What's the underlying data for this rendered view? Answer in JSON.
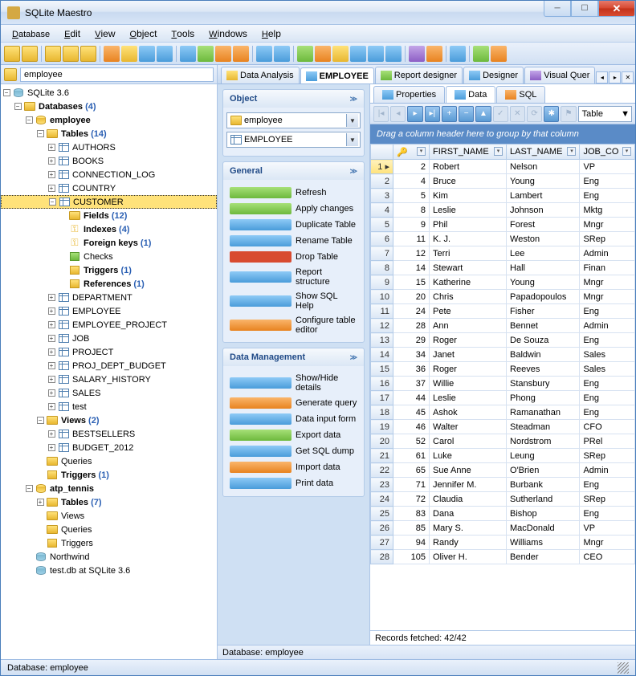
{
  "app": {
    "title": "SQLite Maestro"
  },
  "menus": [
    "Database",
    "Edit",
    "View",
    "Object",
    "Tools",
    "Windows",
    "Help"
  ],
  "addressbar": {
    "value": "employee"
  },
  "tree": {
    "root": {
      "label": "SQLite 3.6"
    },
    "databases": {
      "label": "Databases",
      "count": "(4)"
    },
    "employee": {
      "label": "employee"
    },
    "tables": {
      "label": "Tables",
      "count": "(14)"
    },
    "table_items": [
      "AUTHORS",
      "BOOKS",
      "CONNECTION_LOG",
      "COUNTRY",
      "CUSTOMER"
    ],
    "customer_children": {
      "fields": {
        "label": "Fields",
        "count": "(12)"
      },
      "indexes": {
        "label": "Indexes",
        "count": "(4)"
      },
      "fkeys": {
        "label": "Foreign keys",
        "count": "(1)"
      },
      "checks": {
        "label": "Checks"
      },
      "triggers": {
        "label": "Triggers",
        "count": "(1)"
      },
      "refs": {
        "label": "References",
        "count": "(1)"
      }
    },
    "table_items2": [
      "DEPARTMENT",
      "EMPLOYEE",
      "EMPLOYEE_PROJECT",
      "JOB",
      "PROJECT",
      "PROJ_DEPT_BUDGET",
      "SALARY_HISTORY",
      "SALES",
      "test"
    ],
    "views": {
      "label": "Views",
      "count": "(2)"
    },
    "view_items": [
      "BESTSELLERS",
      "BUDGET_2012"
    ],
    "queries": {
      "label": "Queries"
    },
    "emp_triggers": {
      "label": "Triggers",
      "count": "(1)"
    },
    "atp": {
      "label": "atp_tennis"
    },
    "atp_tables": {
      "label": "Tables",
      "count": "(7)"
    },
    "atp_views": {
      "label": "Views"
    },
    "atp_queries": {
      "label": "Queries"
    },
    "atp_triggers": {
      "label": "Triggers"
    },
    "northwind": {
      "label": "Northwind"
    },
    "testdb": {
      "label": "test.db at SQLite 3.6"
    }
  },
  "task": {
    "object": {
      "title": "Object",
      "db": "employee",
      "table": "EMPLOYEE"
    },
    "general": {
      "title": "General",
      "items": [
        "Refresh",
        "Apply changes",
        "Duplicate Table",
        "Rename Table",
        "Drop Table",
        "Report structure",
        "Show SQL Help",
        "Configure table editor"
      ]
    },
    "datamgmt": {
      "title": "Data Management",
      "items": [
        "Show/Hide details",
        "Generate query",
        "Data input form",
        "Export data",
        "Get SQL dump",
        "Import data",
        "Print data"
      ]
    }
  },
  "doctabs": [
    "Data Analysis",
    "EMPLOYEE",
    "Report designer",
    "Designer",
    "Visual Quer"
  ],
  "subtabs": [
    "Properties",
    "Data",
    "SQL"
  ],
  "grid": {
    "view_mode": "Table",
    "groupbar": "Drag a column header here to group by that column",
    "cols": [
      "",
      "FIRST_NAME",
      "LAST_NAME",
      "JOB_CO"
    ],
    "rows": [
      {
        "n": 1,
        "id": 2,
        "fn": "Robert",
        "ln": "Nelson",
        "jc": "VP"
      },
      {
        "n": 2,
        "id": 4,
        "fn": "Bruce",
        "ln": "Young",
        "jc": "Eng"
      },
      {
        "n": 3,
        "id": 5,
        "fn": "Kim",
        "ln": "Lambert",
        "jc": "Eng"
      },
      {
        "n": 4,
        "id": 8,
        "fn": "Leslie",
        "ln": "Johnson",
        "jc": "Mktg"
      },
      {
        "n": 5,
        "id": 9,
        "fn": "Phil",
        "ln": "Forest",
        "jc": "Mngr"
      },
      {
        "n": 6,
        "id": 11,
        "fn": "K. J.",
        "ln": "Weston",
        "jc": "SRep"
      },
      {
        "n": 7,
        "id": 12,
        "fn": "Terri",
        "ln": "Lee",
        "jc": "Admin"
      },
      {
        "n": 8,
        "id": 14,
        "fn": "Stewart",
        "ln": "Hall",
        "jc": "Finan"
      },
      {
        "n": 9,
        "id": 15,
        "fn": "Katherine",
        "ln": "Young",
        "jc": "Mngr"
      },
      {
        "n": 10,
        "id": 20,
        "fn": "Chris",
        "ln": "Papadopoulos",
        "jc": "Mngr"
      },
      {
        "n": 11,
        "id": 24,
        "fn": "Pete",
        "ln": "Fisher",
        "jc": "Eng"
      },
      {
        "n": 12,
        "id": 28,
        "fn": "Ann",
        "ln": "Bennet",
        "jc": "Admin"
      },
      {
        "n": 13,
        "id": 29,
        "fn": "Roger",
        "ln": "De Souza",
        "jc": "Eng"
      },
      {
        "n": 14,
        "id": 34,
        "fn": "Janet",
        "ln": "Baldwin",
        "jc": "Sales"
      },
      {
        "n": 15,
        "id": 36,
        "fn": "Roger",
        "ln": "Reeves",
        "jc": "Sales"
      },
      {
        "n": 16,
        "id": 37,
        "fn": "Willie",
        "ln": "Stansbury",
        "jc": "Eng"
      },
      {
        "n": 17,
        "id": 44,
        "fn": "Leslie",
        "ln": "Phong",
        "jc": "Eng"
      },
      {
        "n": 18,
        "id": 45,
        "fn": "Ashok",
        "ln": "Ramanathan",
        "jc": "Eng"
      },
      {
        "n": 19,
        "id": 46,
        "fn": "Walter",
        "ln": "Steadman",
        "jc": "CFO"
      },
      {
        "n": 20,
        "id": 52,
        "fn": "Carol",
        "ln": "Nordstrom",
        "jc": "PRel"
      },
      {
        "n": 21,
        "id": 61,
        "fn": "Luke",
        "ln": "Leung",
        "jc": "SRep"
      },
      {
        "n": 22,
        "id": 65,
        "fn": "Sue Anne",
        "ln": "O'Brien",
        "jc": "Admin"
      },
      {
        "n": 23,
        "id": 71,
        "fn": "Jennifer M.",
        "ln": "Burbank",
        "jc": "Eng"
      },
      {
        "n": 24,
        "id": 72,
        "fn": "Claudia",
        "ln": "Sutherland",
        "jc": "SRep"
      },
      {
        "n": 25,
        "id": 83,
        "fn": "Dana",
        "ln": "Bishop",
        "jc": "Eng"
      },
      {
        "n": 26,
        "id": 85,
        "fn": "Mary S.",
        "ln": "MacDonald",
        "jc": "VP"
      },
      {
        "n": 27,
        "id": 94,
        "fn": "Randy",
        "ln": "Williams",
        "jc": "Mngr"
      },
      {
        "n": 28,
        "id": 105,
        "fn": "Oliver H.",
        "ln": "Bender",
        "jc": "CEO"
      }
    ],
    "status": "Records fetched: 42/42"
  },
  "status": {
    "mid": "Database: employee",
    "bottom": "Database: employee"
  }
}
